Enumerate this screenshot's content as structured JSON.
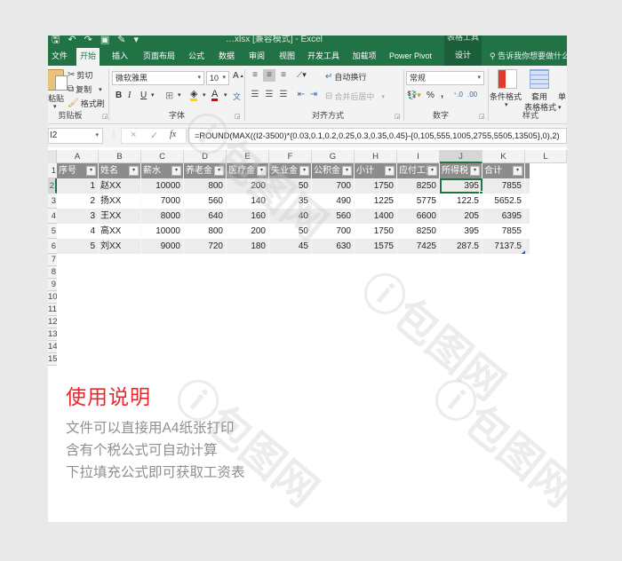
{
  "window": {
    "title": "…xlsx [兼容模式] - Excel",
    "context_group": "表格工具",
    "qat_icons": [
      "save-icon",
      "undo-icon",
      "redo-icon",
      "camera-icon",
      "paint-icon",
      "customize-icon"
    ]
  },
  "tabs": [
    {
      "label": "文件",
      "active": false
    },
    {
      "label": "开始",
      "active": true
    },
    {
      "label": "插入",
      "active": false
    },
    {
      "label": "页面布局",
      "active": false
    },
    {
      "label": "公式",
      "active": false
    },
    {
      "label": "数据",
      "active": false
    },
    {
      "label": "审阅",
      "active": false
    },
    {
      "label": "视图",
      "active": false
    },
    {
      "label": "开发工具",
      "active": false
    },
    {
      "label": "加载项",
      "active": false
    },
    {
      "label": "Power Pivot",
      "active": false
    },
    {
      "label": "设计",
      "active": false,
      "contextual": true
    }
  ],
  "tell_me": "告诉我你想要做什么",
  "ribbon": {
    "clipboard": {
      "paste": "粘贴",
      "cut": "剪切",
      "copy": "复制",
      "format_painter": "格式刷",
      "label": "剪贴板"
    },
    "font": {
      "font_name": "微软雅黑",
      "font_size": "10",
      "bold": "B",
      "italic": "I",
      "underline": "U",
      "label": "字体"
    },
    "alignment": {
      "wrap_text": "自动换行",
      "merge_center": "合并后居中",
      "label": "对齐方式"
    },
    "number": {
      "format": "常规",
      "percent": "%",
      "comma": ",",
      "label": "数字"
    },
    "styles": {
      "conditional_formatting": "条件格式",
      "format_as_table_1": "套用",
      "format_as_table_2": "表格格式",
      "cell_styles": "单",
      "label": "样式"
    }
  },
  "formula_bar": {
    "name_box": "I2",
    "cancel": "×",
    "enter": "✓",
    "fx": "fx",
    "formula": "=ROUND(MAX((I2-3500)*{0.03,0.1,0.2,0.25,0.3,0.35,0.45}-{0,105,555,1005,2755,5505,13505},0),2)"
  },
  "columns": [
    "A",
    "B",
    "C",
    "D",
    "E",
    "F",
    "G",
    "H",
    "I",
    "J",
    "K",
    "L"
  ],
  "selected_column": "J",
  "rows": [
    "1",
    "2",
    "3",
    "4",
    "5",
    "6",
    "7",
    "8",
    "9",
    "10",
    "11",
    "12",
    "13",
    "14",
    "15"
  ],
  "selected_row": "2",
  "table": {
    "headers": [
      "序号",
      "姓名",
      "薪水",
      "养老金",
      "医疗金",
      "失业金",
      "公积金",
      "小计",
      "应付工资",
      "所得税",
      "合计"
    ],
    "rows": [
      [
        "1",
        "赵XX",
        "10000",
        "800",
        "200",
        "50",
        "700",
        "1750",
        "8250",
        "395",
        "7855"
      ],
      [
        "2",
        "扬XX",
        "7000",
        "560",
        "140",
        "35",
        "490",
        "1225",
        "5775",
        "122.5",
        "5652.5"
      ],
      [
        "3",
        "王XX",
        "8000",
        "640",
        "160",
        "40",
        "560",
        "1400",
        "6600",
        "205",
        "6395"
      ],
      [
        "4",
        "高XX",
        "10000",
        "800",
        "200",
        "50",
        "700",
        "1750",
        "8250",
        "395",
        "7855"
      ],
      [
        "5",
        "刘XX",
        "9000",
        "720",
        "180",
        "45",
        "630",
        "1575",
        "7425",
        "287.5",
        "7137.5"
      ]
    ],
    "active_cell": "J2"
  },
  "instructions": {
    "title": "使用说明",
    "lines": [
      "文件可以直接用A4纸张打印",
      "含有个税公式可自动计算",
      "下拉填充公式即可获取工资表"
    ]
  },
  "colors": {
    "excel_green": "#217346",
    "instruction_title": "#e8282d",
    "instruction_text": "#8f8f8f",
    "table_header": "#8c8c8c",
    "band_row": "#ececec"
  }
}
